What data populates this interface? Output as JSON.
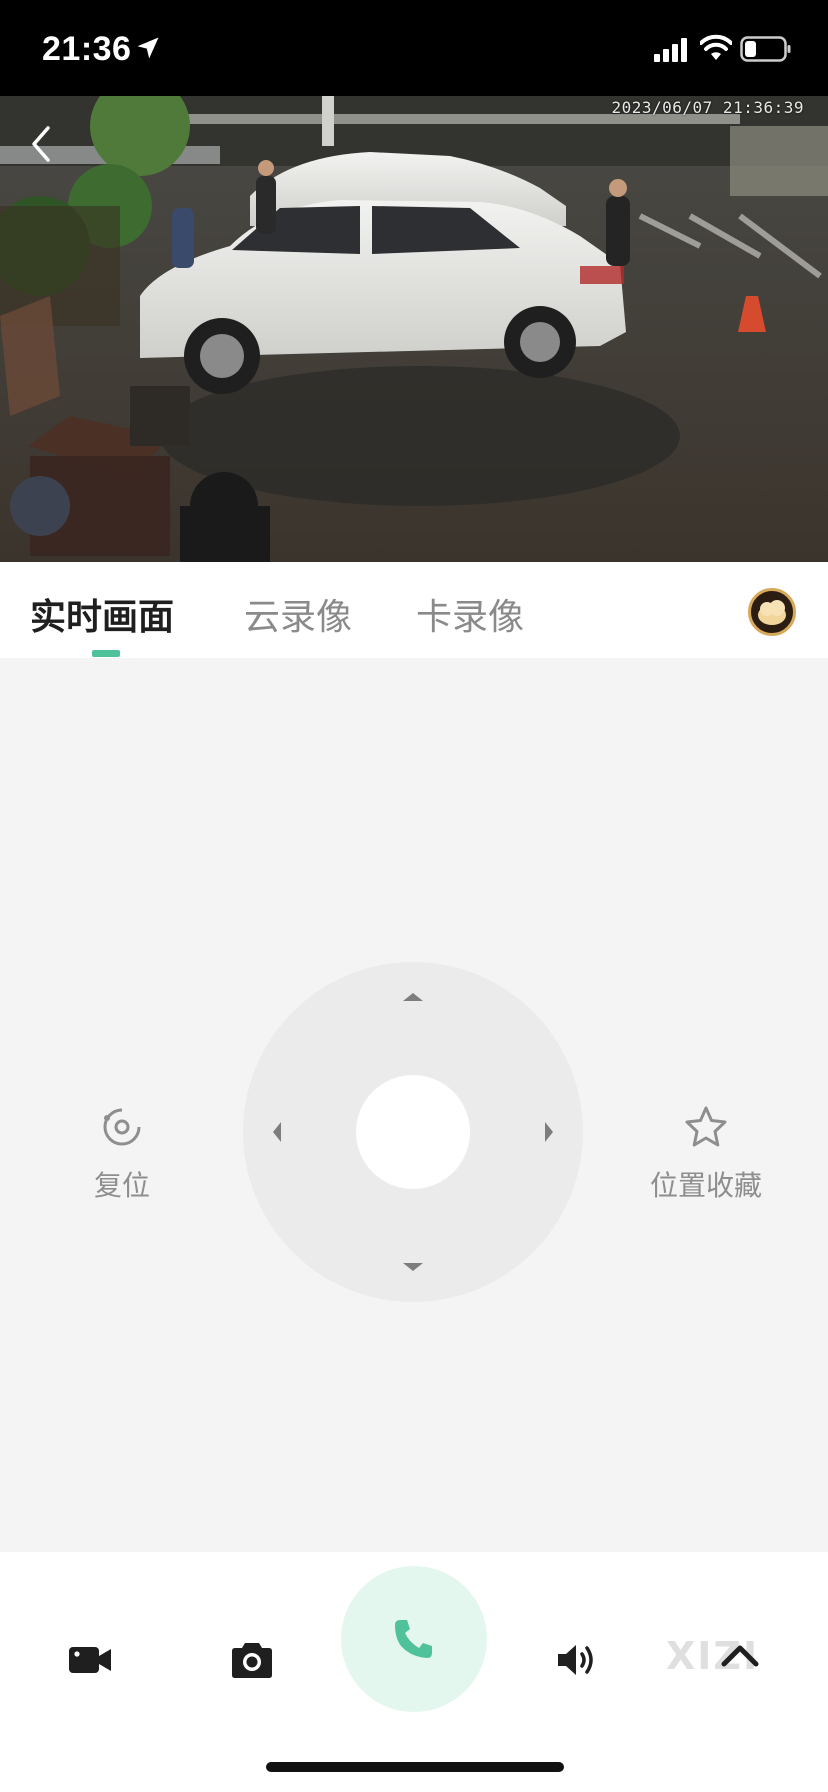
{
  "status_bar": {
    "time": "21:36",
    "icons": [
      "location-arrow-icon",
      "cellular-signal-icon",
      "wifi-icon",
      "battery-icon"
    ]
  },
  "feed": {
    "osd_timestamp": "2023/06/07 21:36:39"
  },
  "tabs": [
    {
      "label": "实时画面",
      "active": true
    },
    {
      "label": "云录像",
      "active": false
    },
    {
      "label": "卡录像",
      "active": false
    }
  ],
  "controls": {
    "reset_label": "复位",
    "favorite_label": "位置收藏"
  },
  "toolbar": {
    "items": [
      "video-record-icon",
      "camera-snapshot-icon",
      "phone-talk-icon",
      "speaker-volume-icon",
      "chevron-up-icon"
    ],
    "watermark": "XIZI"
  },
  "colors": {
    "accent": "#4fc29c",
    "talk_bg": "#e3f7ef",
    "panel_bg": "#f4f4f4",
    "dpad_bg": "#ebebeb"
  }
}
